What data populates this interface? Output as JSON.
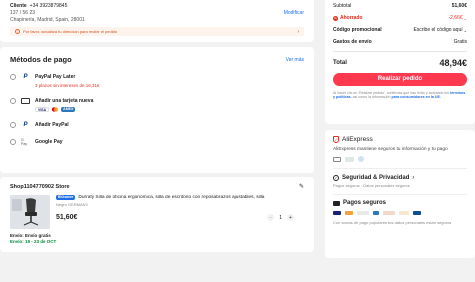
{
  "address": {
    "name_label": "Cliente",
    "phone": "+34 3923879845",
    "street": "137 / 56 23",
    "city_line": "Chapinería, Madrid, Spain, 28001",
    "modify_label": "Modificar",
    "notice": "Por favor, actualiza tu dirección para recibir el pedido"
  },
  "payment": {
    "title": "Métodos de pago",
    "see_more": "Ver más",
    "methods": [
      {
        "label": "PayPal Pay Later",
        "sub": "3 plazos sin intereses de 16,31€"
      },
      {
        "label": "Añadir una tarjeta nueva",
        "cards": [
          "VISA",
          "MC",
          "AMEX"
        ]
      },
      {
        "label": "Añadir PayPal"
      },
      {
        "label": "Google Pay",
        "badge": "G Pay"
      }
    ]
  },
  "store": {
    "name": "Shop1104770902 Store",
    "badge": "BIGsaver",
    "product_title": "Durrafy Silla de oficina ergonómica, silla de escritorio con reposabrazos ajustables, silla",
    "variant": "Negro GERMANY",
    "price": "51,60€",
    "quantity": "1",
    "shipping": "Envío: Envío gratis",
    "delivery": "Envío: 19 - 23 de OCT"
  },
  "summary": {
    "subtotal_label": "Subtotal",
    "subtotal_value": "51,60€",
    "saved_label": "Ahorrado",
    "saved_value": "-2,66€",
    "promo_label": "Código promocional",
    "promo_value": "Escribe el código aquí",
    "shipping_label": "Gastos de envío",
    "shipping_value": "Gratis",
    "total_label": "Total",
    "total_value": "48,94€",
    "order_button": "Realizar pedido",
    "legal_1": "Al hacer clic en 'Realizar pedido', confirmas que has leído y",
    "legal_2": "aceptado los",
    "legal_link": "términos y políticas",
    "legal_3": ", así como la información",
    "legal_4": "para consumidores en la UE."
  },
  "trust": {
    "brand": "AliExpress",
    "text": "AliExpress mantiene seguros tu información y tu pago",
    "security_title": "Seguridad & Privacidad",
    "security_sub": "Pagos seguros · Datos personales seguros",
    "secure_title": "Pagos seguros",
    "secure_sub": "Con socios de pago populares tus datos personales están seguros"
  },
  "colors": {
    "accent": "#fd384f",
    "link": "#1f6ee6",
    "red": "#e62e20"
  }
}
